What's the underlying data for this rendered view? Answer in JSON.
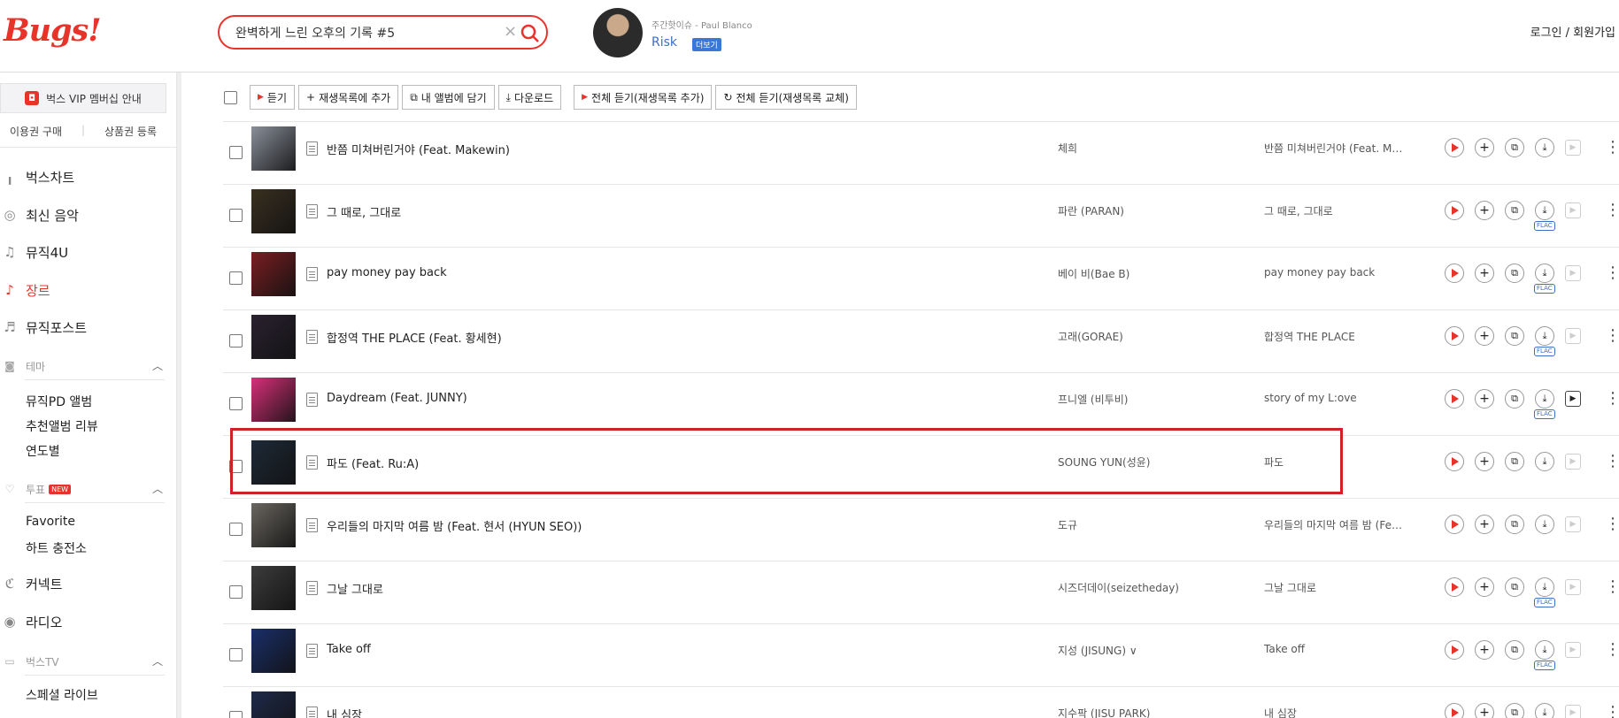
{
  "header": {
    "logo": "Bugs!",
    "search_value": "완벽하게 느린 오후의 기록 #5",
    "now": {
      "caption": "주간핫이슈 - Paul Blanco",
      "title": "Risk",
      "more": "더보기"
    },
    "auth": "로그인 / 회원가입"
  },
  "sidebar": {
    "vip": "벅스 VIP 멤버십 안내",
    "buy": "이용권 구매",
    "voucher": "상품권 등록",
    "menu": [
      {
        "label": "벅스차트",
        "icon": "chart-icon"
      },
      {
        "label": "최신 음악",
        "icon": "disc-icon"
      },
      {
        "label": "뮤직4U",
        "icon": "music-note-icon"
      },
      {
        "label": "장르",
        "icon": "guitar-icon",
        "active": true
      },
      {
        "label": "뮤직포스트",
        "icon": "post-icon"
      }
    ],
    "theme": {
      "label": "테마",
      "items": [
        "뮤직PD 앨범",
        "추천앨범 리뷰",
        "연도별"
      ]
    },
    "vote": {
      "label": "투표",
      "badge": "NEW",
      "items": [
        "Favorite",
        "하트 충전소"
      ]
    },
    "connect": "커넥트",
    "radio": "라디오",
    "tv": {
      "label": "벅스TV",
      "items": [
        "스페셜 라이브"
      ]
    }
  },
  "toolbar": {
    "listen": "듣기",
    "add_playlist": "재생목록에 추가",
    "add_album": "내 앨범에 담기",
    "download": "다운로드",
    "listen_all_add": "전체 듣기(재생목록 추가)",
    "listen_all_replace": "전체 듣기(재생목록 교체)"
  },
  "tracks": [
    {
      "title": "반쯤 미쳐버린거야 (Feat. Makewin)",
      "artist": "체희",
      "album": "반쯤 미쳐버린거야 (Feat. Ma…",
      "flac": false,
      "mv": false
    },
    {
      "title": "그 때로, 그대로",
      "artist": "파란 (PARAN)",
      "album": "그 때로, 그대로",
      "flac": true,
      "mv": false
    },
    {
      "title": "pay money pay back",
      "artist": "베이 비(Bae B)",
      "album": "pay money pay back",
      "flac": true,
      "mv": false
    },
    {
      "title": "합정역 THE PLACE (Feat. 황세현)",
      "artist": "고래(GORAE)",
      "album": "합정역 THE PLACE",
      "flac": true,
      "mv": false
    },
    {
      "title": "Daydream (Feat. JUNNY)",
      "artist": "프니엘 (비투비)",
      "album": "story of my L:ove",
      "flac": true,
      "mv": true
    },
    {
      "title": "파도 (Feat. Ru:A)",
      "artist": "SOUNG YUN(성윤)",
      "album": "파도",
      "flac": false,
      "mv": false
    },
    {
      "title": "우리들의 마지막 여름 밤 (Feat. 현서 (HYUN SEO))",
      "artist": "도규",
      "album": "우리들의 마지막 여름 밤 (Feat…",
      "flac": false,
      "mv": false
    },
    {
      "title": "그날 그대로",
      "artist": "시즈더데이(seizetheday)",
      "album": "그날 그대로",
      "flac": true,
      "mv": false
    },
    {
      "title": "Take off",
      "artist": "지성 (JISUNG) ∨",
      "album": "Take off",
      "flac": true,
      "mv": false
    },
    {
      "title": "내 심장",
      "artist": "지수팍 (JISU PARK)",
      "album": "내 심장",
      "flac": false,
      "mv": false
    }
  ],
  "thumb_colors": [
    "#8a8f9a",
    "#3a3020",
    "#7a1e22",
    "#2a2230",
    "#d8307a",
    "#1e2a38",
    "#6a6660",
    "#3c3c3c",
    "#1a2f6a",
    "#1e2a4a"
  ],
  "colors": {
    "brand": "#e8332b",
    "highlight": "#d0202a",
    "link": "#3a6ec8"
  }
}
